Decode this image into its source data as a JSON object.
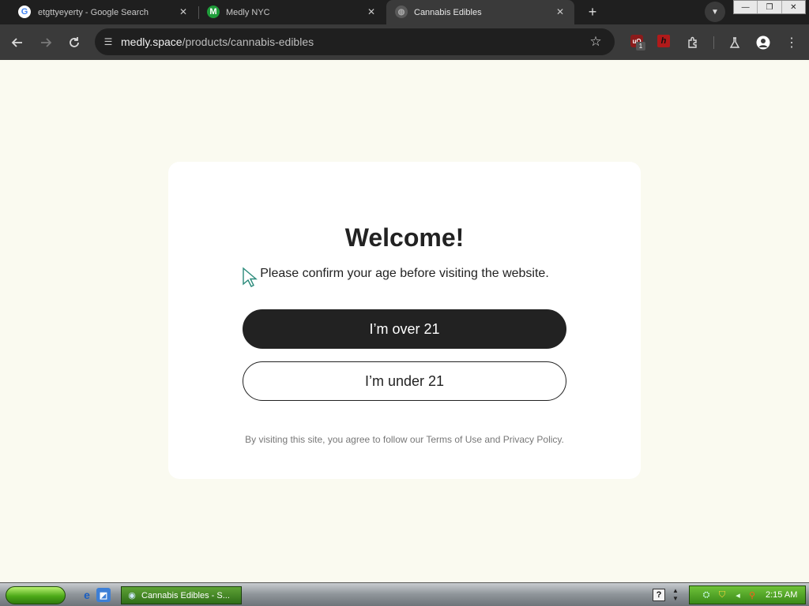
{
  "browser": {
    "tabs": [
      {
        "title": "etgttyeyerty - Google Search",
        "favicon": "google-g-icon",
        "active": false
      },
      {
        "title": "Medly NYC",
        "favicon": "medly-m-icon",
        "active": false
      },
      {
        "title": "Cannabis Edibles",
        "favicon": "globe-icon",
        "active": true
      }
    ],
    "omnibox": {
      "host": "medly.space",
      "path": "/products/cannabis-edibles"
    },
    "extensions": {
      "ublock_badge": "1"
    }
  },
  "modal": {
    "title": "Welcome!",
    "subtitle": "Please confirm your age before visiting the website.",
    "primary_button": "I’m over 21",
    "secondary_button": "I’m under 21",
    "footer": "By visiting this site, you agree to follow our Terms of Use and Privacy Policy."
  },
  "taskbar": {
    "task_label": "Cannabis Edibles - S...",
    "clock": "2:15 AM"
  },
  "colors": {
    "page_background": "#fafaf0",
    "primary_button": "#222222",
    "browser_frame": "#1f1f1f"
  }
}
